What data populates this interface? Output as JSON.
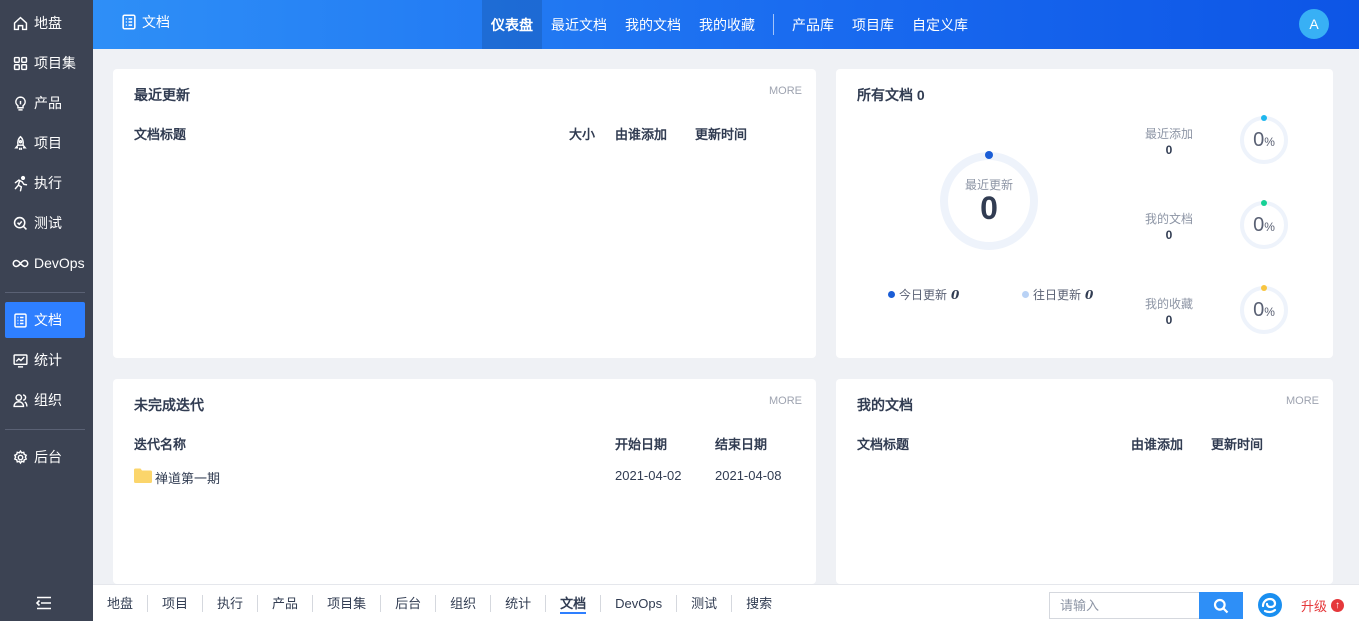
{
  "sidebar": {
    "items": [
      {
        "label": "地盘",
        "icon": "home-icon"
      },
      {
        "label": "项目集",
        "icon": "grid-icon"
      },
      {
        "label": "产品",
        "icon": "bulb-icon"
      },
      {
        "label": "项目",
        "icon": "rocket-icon"
      },
      {
        "label": "执行",
        "icon": "run-icon"
      },
      {
        "label": "测试",
        "icon": "test-icon"
      },
      {
        "label": "DevOps",
        "icon": "infinity-icon"
      },
      {
        "label": "文档",
        "icon": "doc-icon",
        "active": true
      },
      {
        "label": "统计",
        "icon": "chart-icon"
      },
      {
        "label": "组织",
        "icon": "users-icon"
      },
      {
        "label": "后台",
        "icon": "gear-icon"
      }
    ]
  },
  "header": {
    "title": "文档",
    "tabs": [
      "仪表盘",
      "最近文档",
      "我的文档",
      "我的收藏",
      "产品库",
      "项目库",
      "自定义库"
    ],
    "active_tab": "仪表盘",
    "avatar": "A"
  },
  "recent_updates": {
    "title": "最近更新",
    "more": "MORE",
    "columns": [
      "文档标题",
      "大小",
      "由谁添加",
      "更新时间"
    ]
  },
  "all_docs": {
    "title": "所有文档 0",
    "ring_label": "最近更新",
    "ring_value": "0",
    "legend_today": "今日更新",
    "legend_today_value": "0",
    "legend_past": "往日更新",
    "legend_past_value": "0",
    "stats": [
      {
        "label": "最近添加",
        "value": "0",
        "percent": "0",
        "unit": "%",
        "color": "#1fb7ee"
      },
      {
        "label": "我的文档",
        "value": "0",
        "percent": "0",
        "unit": "%",
        "color": "#16d195"
      },
      {
        "label": "我的收藏",
        "value": "0",
        "percent": "0",
        "unit": "%",
        "color": "#f8c540"
      }
    ]
  },
  "iterations": {
    "title": "未完成迭代",
    "more": "MORE",
    "columns": [
      "迭代名称",
      "开始日期",
      "结束日期"
    ],
    "rows": [
      {
        "name": "禅道第一期",
        "start": "2021-04-02",
        "end": "2021-04-08"
      }
    ]
  },
  "my_docs": {
    "title": "我的文档",
    "more": "MORE",
    "columns": [
      "文档标题",
      "由谁添加",
      "更新时间"
    ]
  },
  "bottombar": {
    "crumbs": [
      "地盘",
      "项目",
      "执行",
      "产品",
      "项目集",
      "后台",
      "组织",
      "统计",
      "文档",
      "DevOps",
      "测试",
      "搜索"
    ],
    "active_crumb": "文档",
    "search_placeholder": "请输入",
    "upgrade": "升级"
  },
  "colors": {
    "accent": "#2e7fff",
    "sidebar_bg": "#3c4353",
    "ring_track": "#eef3fb",
    "ring_dot": "#1a5dd6",
    "legend_past_dot": "#b9d2f5",
    "upgrade_red": "#e5383b"
  }
}
